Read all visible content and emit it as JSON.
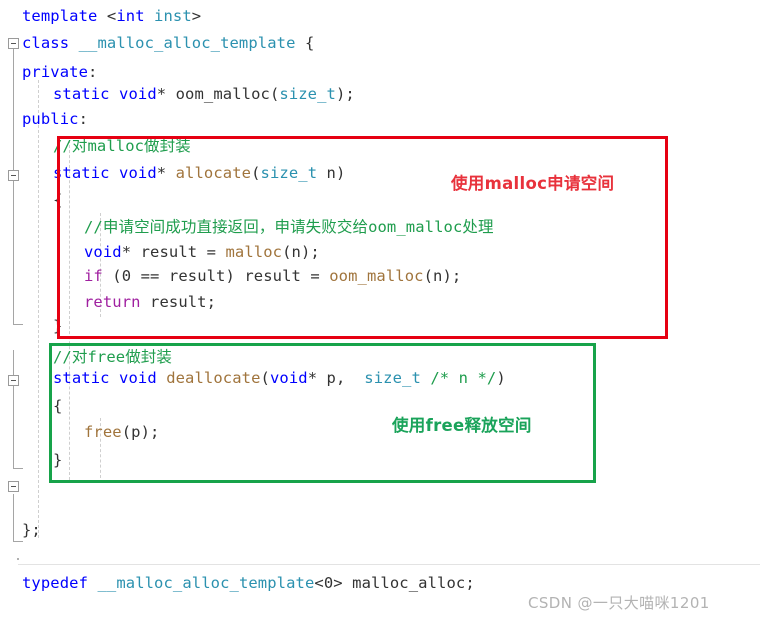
{
  "editor": {
    "language": "cpp",
    "background_color": "#ffffff",
    "syntax_colors": {
      "keyword": "#0000ff",
      "control": "#a020a0",
      "type": "#2b91af",
      "function": "#a0743c",
      "comment": "#1f9d4d",
      "plain": "#333333"
    },
    "code_lines": [
      {
        "indent": 0,
        "tokens": [
          {
            "t": "template ",
            "c": "kw"
          },
          {
            "t": "<",
            "c": "plain"
          },
          {
            "t": "int",
            "c": "kw"
          },
          {
            "t": " inst",
            "c": "type"
          },
          {
            "t": ">",
            "c": "plain"
          }
        ]
      },
      {
        "indent": 0,
        "tokens": [
          {
            "t": "class ",
            "c": "kw"
          },
          {
            "t": "__malloc_alloc_template",
            "c": "type"
          },
          {
            "t": " {",
            "c": "plain"
          }
        ]
      },
      {
        "indent": 0,
        "tokens": [
          {
            "t": "private",
            "c": "kw"
          },
          {
            "t": ":",
            "c": "plain"
          }
        ]
      },
      {
        "indent": 1,
        "tokens": [
          {
            "t": "static void",
            "c": "kw"
          },
          {
            "t": "* ",
            "c": "plain"
          },
          {
            "t": "oom_malloc",
            "c": "plain"
          },
          {
            "t": "(",
            "c": "plain"
          },
          {
            "t": "size_t",
            "c": "type"
          },
          {
            "t": ");",
            "c": "plain"
          }
        ]
      },
      {
        "indent": 0,
        "tokens": [
          {
            "t": "public",
            "c": "kw"
          },
          {
            "t": ":",
            "c": "plain"
          }
        ]
      },
      {
        "indent": 1,
        "tokens": [
          {
            "t": "//对malloc做封装",
            "c": "cmt"
          }
        ]
      },
      {
        "indent": 1,
        "tokens": [
          {
            "t": "static void",
            "c": "kw"
          },
          {
            "t": "* ",
            "c": "plain"
          },
          {
            "t": "allocate",
            "c": "fn"
          },
          {
            "t": "(",
            "c": "plain"
          },
          {
            "t": "size_t",
            "c": "type"
          },
          {
            "t": " n)",
            "c": "plain"
          }
        ]
      },
      {
        "indent": 1,
        "tokens": [
          {
            "t": "{",
            "c": "plain"
          }
        ]
      },
      {
        "indent": 2,
        "tokens": [
          {
            "t": "//申请空间成功直接返回，申请失败交给oom_malloc处理",
            "c": "cmt"
          }
        ]
      },
      {
        "indent": 2,
        "tokens": [
          {
            "t": "void",
            "c": "kw"
          },
          {
            "t": "* result = ",
            "c": "plain"
          },
          {
            "t": "malloc",
            "c": "fn"
          },
          {
            "t": "(n);",
            "c": "plain"
          }
        ]
      },
      {
        "indent": 2,
        "tokens": [
          {
            "t": "if",
            "c": "ctrl"
          },
          {
            "t": " (0 == result) result = ",
            "c": "plain"
          },
          {
            "t": "oom_malloc",
            "c": "fn"
          },
          {
            "t": "(n);",
            "c": "plain"
          }
        ]
      },
      {
        "indent": 2,
        "tokens": [
          {
            "t": "return",
            "c": "ctrl"
          },
          {
            "t": " result;",
            "c": "plain"
          }
        ]
      },
      {
        "indent": 1,
        "tokens": [
          {
            "t": "}",
            "c": "plain"
          }
        ]
      },
      {
        "indent": 1,
        "tokens": [
          {
            "t": "//对free做封装",
            "c": "cmt"
          }
        ]
      },
      {
        "indent": 1,
        "tokens": [
          {
            "t": "static void",
            "c": "kw"
          },
          {
            "t": " ",
            "c": "plain"
          },
          {
            "t": "deallocate",
            "c": "fn"
          },
          {
            "t": "(",
            "c": "plain"
          },
          {
            "t": "void",
            "c": "kw"
          },
          {
            "t": "* p,  ",
            "c": "plain"
          },
          {
            "t": "size_t",
            "c": "type"
          },
          {
            "t": " ",
            "c": "plain"
          },
          {
            "t": "/* n */",
            "c": "cmt"
          },
          {
            "t": ")",
            "c": "plain"
          }
        ]
      },
      {
        "indent": 1,
        "tokens": [
          {
            "t": "{",
            "c": "plain"
          }
        ]
      },
      {
        "indent": 2,
        "tokens": [
          {
            "t": "free",
            "c": "fn"
          },
          {
            "t": "(p);",
            "c": "plain"
          }
        ]
      },
      {
        "indent": 1,
        "tokens": [
          {
            "t": "}",
            "c": "plain"
          }
        ]
      },
      {
        "indent": 0,
        "tokens": [
          {
            "t": "};",
            "c": "plain"
          }
        ]
      },
      {
        "indent": 0,
        "tokens": [
          {
            "t": "typedef ",
            "c": "kw"
          },
          {
            "t": "__malloc_alloc_template",
            "c": "type"
          },
          {
            "t": "<0> malloc_alloc;",
            "c": "plain"
          }
        ]
      }
    ]
  },
  "annotations": [
    {
      "id": "allocate-highlight",
      "shape": "rectangle",
      "color": "#e60012",
      "label": "使用malloc申请空间",
      "label_color": "#e8323c"
    },
    {
      "id": "deallocate-highlight",
      "shape": "rectangle",
      "color": "#17a34a",
      "label": "使用free释放空间",
      "label_color": "#1aa35a"
    }
  ],
  "watermark": {
    "text": "CSDN @一只大喵咪1201",
    "color": "#b3b3b3"
  }
}
